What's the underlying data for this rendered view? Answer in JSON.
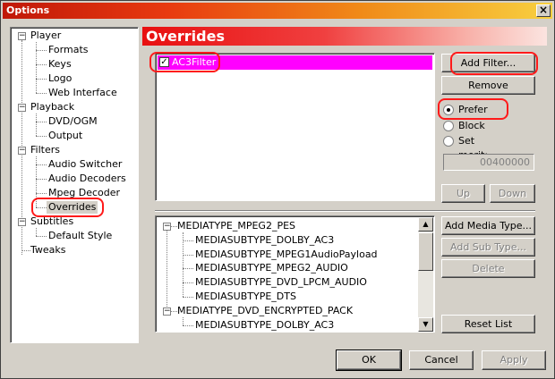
{
  "window": {
    "title": "Options",
    "close_glyph": "×"
  },
  "tree": {
    "items": [
      {
        "label": "Player",
        "children": [
          "Formats",
          "Keys",
          "Logo",
          "Web Interface"
        ]
      },
      {
        "label": "Playback",
        "children": [
          "DVD/OGM",
          "Output"
        ]
      },
      {
        "label": "Filters",
        "children": [
          "Audio Switcher",
          "Audio Decoders",
          "Mpeg Decoder",
          "Overrides"
        ]
      },
      {
        "label": "Subtitles",
        "children": [
          "Default Style"
        ]
      },
      {
        "label": "Tweaks",
        "children": []
      }
    ],
    "expander_glyph": "−",
    "selected": "Overrides"
  },
  "panel": {
    "title": "Overrides"
  },
  "filters": {
    "rows": [
      {
        "name": "AC3Filter",
        "checked": true
      }
    ],
    "check_glyph": "✓"
  },
  "buttons": {
    "add_filter": "Add Filter...",
    "remove": "Remove",
    "up": "Up",
    "down": "Down",
    "add_media_type": "Add Media Type...",
    "add_sub_type": "Add Sub Type...",
    "delete": "Delete",
    "reset_list": "Reset List",
    "ok": "OK",
    "cancel": "Cancel",
    "apply": "Apply"
  },
  "merit": {
    "options": [
      "Prefer",
      "Block",
      "Set merit:"
    ],
    "selected": "Prefer",
    "value": "00400000"
  },
  "media_types": {
    "groups": [
      {
        "type": "MEDIATYPE_MPEG2_PES",
        "subtypes": [
          "MEDIASUBTYPE_DOLBY_AC3",
          "MEDIASUBTYPE_MPEG1AudioPayload",
          "MEDIASUBTYPE_MPEG2_AUDIO",
          "MEDIASUBTYPE_DVD_LPCM_AUDIO",
          "MEDIASUBTYPE_DTS"
        ]
      },
      {
        "type": "MEDIATYPE_DVD_ENCRYPTED_PACK",
        "subtypes": [
          "MEDIASUBTYPE_DOLBY_AC3"
        ]
      }
    ]
  },
  "scrollbar": {
    "up_glyph": "▲",
    "down_glyph": "▼"
  },
  "annotation_color": "#ff1a1a"
}
